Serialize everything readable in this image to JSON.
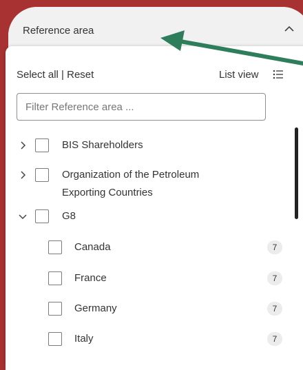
{
  "header": {
    "title": "Reference area"
  },
  "background": {
    "fragment": "t"
  },
  "panel": {
    "select_all": "Select all",
    "separator": "|",
    "reset": "Reset",
    "list_view": "List view",
    "filter_placeholder": "Filter Reference area ..."
  },
  "items": [
    {
      "label": "BIS Shareholders",
      "expanded": false
    },
    {
      "label_line1": "Organization of the Petroleum",
      "label_line2": "Exporting Countries",
      "expanded": false
    },
    {
      "label": "G8",
      "expanded": true
    }
  ],
  "children": [
    {
      "label": "Canada",
      "count": "7"
    },
    {
      "label": "France",
      "count": "7"
    },
    {
      "label": "Germany",
      "count": "7"
    },
    {
      "label": "Italy",
      "count": "7"
    }
  ],
  "colors": {
    "frame_bg": "#a83232",
    "arrow": "#2e7d5b"
  }
}
